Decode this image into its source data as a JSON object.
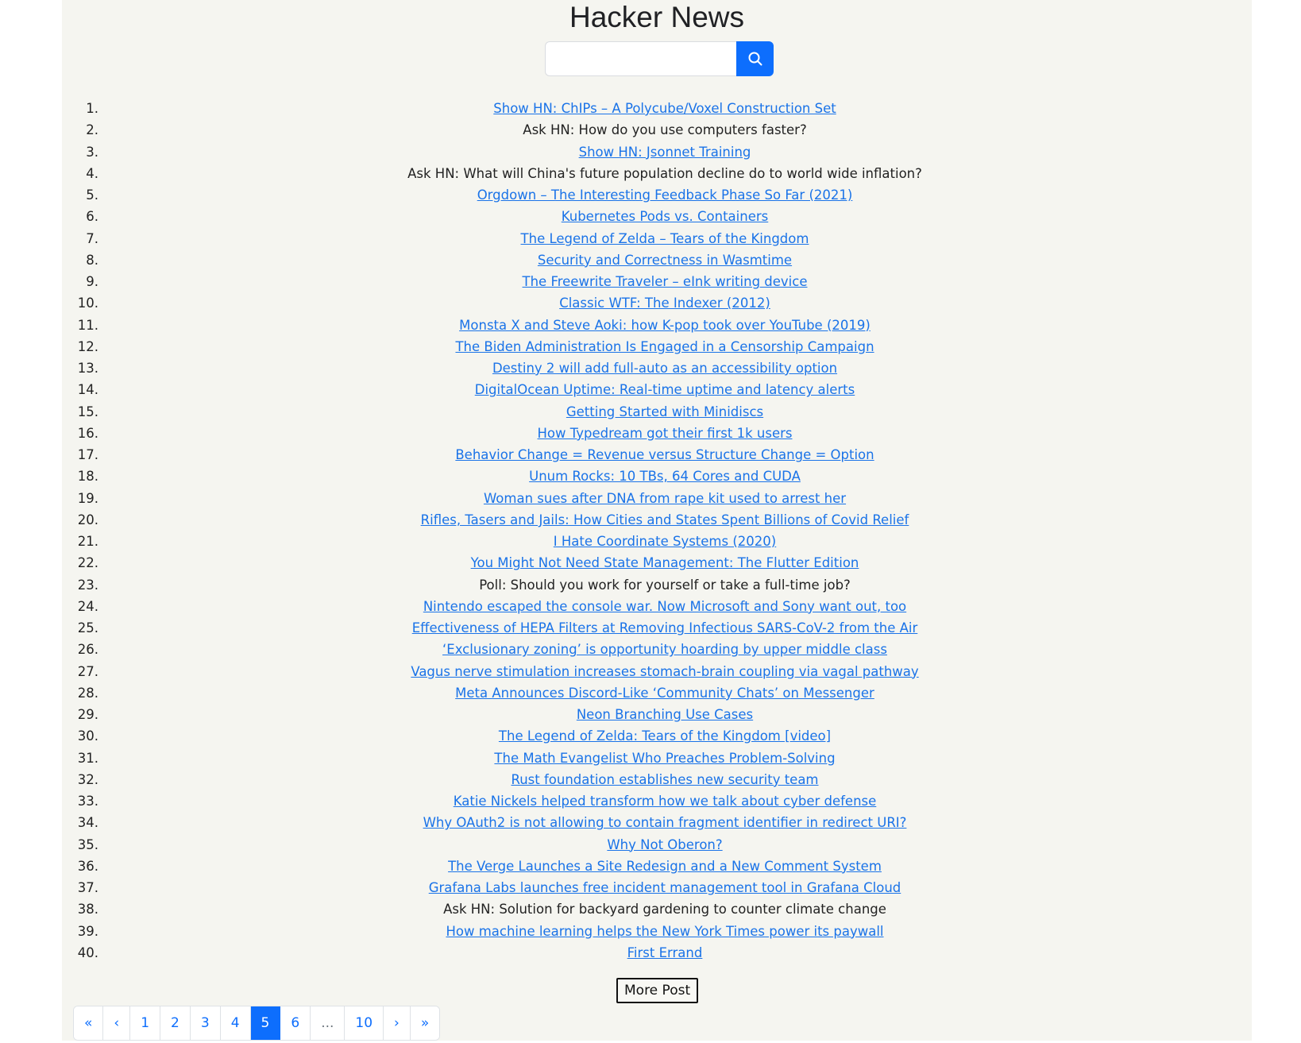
{
  "header": {
    "title": "Hacker News"
  },
  "search": {
    "value": "",
    "placeholder": "",
    "button_icon": "search-icon"
  },
  "stories": [
    {
      "num": "1.",
      "title": "Show HN: ChIPs – A Polycube/Voxel Construction Set",
      "link": true
    },
    {
      "num": "2.",
      "title": "Ask HN: How do you use computers faster?",
      "link": false
    },
    {
      "num": "3.",
      "title": "Show HN: Jsonnet Training",
      "link": true
    },
    {
      "num": "4.",
      "title": "Ask HN: What will China's future population decline do to world wide inflation?",
      "link": false
    },
    {
      "num": "5.",
      "title": "Orgdown – The Interesting Feedback Phase So Far (2021)",
      "link": true
    },
    {
      "num": "6.",
      "title": "Kubernetes Pods vs. Containers",
      "link": true
    },
    {
      "num": "7.",
      "title": "The Legend of Zelda – Tears of the Kingdom",
      "link": true
    },
    {
      "num": "8.",
      "title": "Security and Correctness in Wasmtime",
      "link": true
    },
    {
      "num": "9.",
      "title": "The Freewrite Traveler – eInk writing device",
      "link": true
    },
    {
      "num": "10.",
      "title": "Classic WTF: The Indexer (2012)",
      "link": true
    },
    {
      "num": "11.",
      "title": "Monsta X and Steve Aoki: how K-pop took over YouTube (2019)",
      "link": true
    },
    {
      "num": "12.",
      "title": "The Biden Administration Is Engaged in a Censorship Campaign",
      "link": true
    },
    {
      "num": "13.",
      "title": "Destiny 2 will add full-auto as an accessibility option",
      "link": true
    },
    {
      "num": "14.",
      "title": "DigitalOcean Uptime: Real-time uptime and latency alerts",
      "link": true
    },
    {
      "num": "15.",
      "title": "Getting Started with Minidiscs",
      "link": true
    },
    {
      "num": "16.",
      "title": "How Typedream got their first 1k users",
      "link": true
    },
    {
      "num": "17.",
      "title": "Behavior Change = Revenue versus Structure Change = Option",
      "link": true
    },
    {
      "num": "18.",
      "title": "Unum Rocks: 10 TBs, 64 Cores and CUDA",
      "link": true
    },
    {
      "num": "19.",
      "title": "Woman sues after DNA from rape kit used to arrest her",
      "link": true
    },
    {
      "num": "20.",
      "title": "Rifles, Tasers and Jails: How Cities and States Spent Billions of Covid Relief",
      "link": true
    },
    {
      "num": "21.",
      "title": "I Hate Coordinate Systems (2020)",
      "link": true
    },
    {
      "num": "22.",
      "title": "You Might Not Need State Management: The Flutter Edition",
      "link": true
    },
    {
      "num": "23.",
      "title": "Poll: Should you work for yourself or take a full-time job?",
      "link": false
    },
    {
      "num": "24.",
      "title": "Nintendo escaped the console war. Now Microsoft and Sony want out, too",
      "link": true
    },
    {
      "num": "25.",
      "title": "Effectiveness of HEPA Filters at Removing Infectious SARS-CoV-2 from the Air",
      "link": true
    },
    {
      "num": "26.",
      "title": "‘Exclusionary zoning’ is opportunity hoarding by upper middle class",
      "link": true
    },
    {
      "num": "27.",
      "title": "Vagus nerve stimulation increases stomach-brain coupling via vagal pathway",
      "link": true
    },
    {
      "num": "28.",
      "title": "Meta Announces Discord-Like ‘Community Chats’ on Messenger",
      "link": true
    },
    {
      "num": "29.",
      "title": "Neon Branching Use Cases",
      "link": true
    },
    {
      "num": "30.",
      "title": "The Legend of Zelda: Tears of the Kingdom [video]",
      "link": true
    },
    {
      "num": "31.",
      "title": "The Math Evangelist Who Preaches Problem-Solving",
      "link": true
    },
    {
      "num": "32.",
      "title": "Rust foundation establishes new security team",
      "link": true
    },
    {
      "num": "33.",
      "title": "Katie Nickels helped transform how we talk about cyber defense",
      "link": true
    },
    {
      "num": "34.",
      "title": "Why OAuth2 is not allowing to contain fragment identifier in redirect URI?",
      "link": true
    },
    {
      "num": "35.",
      "title": "Why Not Oberon?",
      "link": true
    },
    {
      "num": "36.",
      "title": "The Verge Launches a Site Redesign and a New Comment System",
      "link": true
    },
    {
      "num": "37.",
      "title": "Grafana Labs launches free incident management tool in Grafana Cloud",
      "link": true
    },
    {
      "num": "38.",
      "title": "Ask HN: Solution for backyard gardening to counter climate change",
      "link": false
    },
    {
      "num": "39.",
      "title": "How machine learning helps the New York Times power its paywall",
      "link": true
    },
    {
      "num": "40.",
      "title": "First Errand",
      "link": true
    }
  ],
  "more_button": {
    "label": "More Post"
  },
  "pagination": {
    "items": [
      {
        "label": "«",
        "name": "page-first"
      },
      {
        "label": "‹",
        "name": "page-prev"
      },
      {
        "label": "1",
        "name": "page-1"
      },
      {
        "label": "2",
        "name": "page-2"
      },
      {
        "label": "3",
        "name": "page-3"
      },
      {
        "label": "4",
        "name": "page-4"
      },
      {
        "label": "5",
        "name": "page-5",
        "active": true
      },
      {
        "label": "6",
        "name": "page-6"
      },
      {
        "label": "...",
        "name": "page-ellipsis",
        "muted": true
      },
      {
        "label": "10",
        "name": "page-10"
      },
      {
        "label": "›",
        "name": "page-next"
      },
      {
        "label": "»",
        "name": "page-last"
      }
    ]
  },
  "colors": {
    "accent": "#0d6efd",
    "link": "#1a73e8",
    "background": "#f5f5f0"
  }
}
